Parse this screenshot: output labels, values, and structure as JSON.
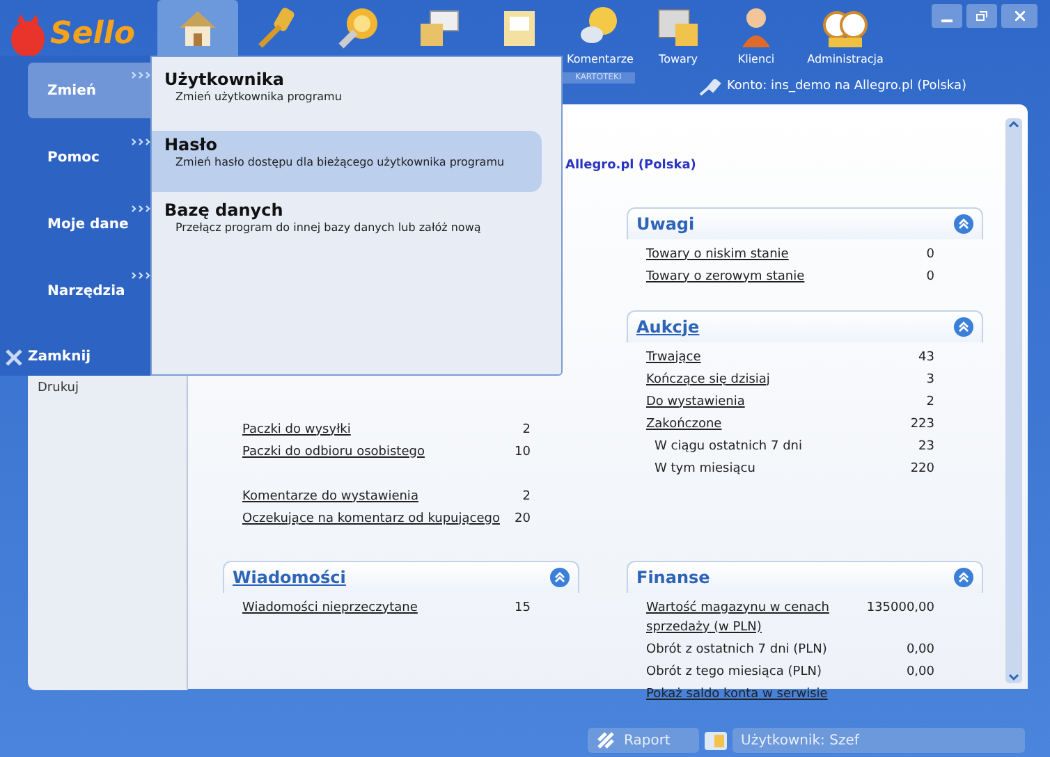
{
  "logo": "Sello",
  "toolbar": [
    {
      "selected": true
    },
    {
      "selected": false
    },
    {
      "selected": false
    },
    {
      "selected": false
    },
    {
      "selected": false
    },
    {
      "label": "Komentarze",
      "selected": false
    },
    {
      "label": "Towary",
      "selected": false
    },
    {
      "label": "Klienci",
      "selected": false
    },
    {
      "label": "Administracja",
      "selected": false
    }
  ],
  "toolbar_group_label": "KARTOTEKI",
  "account": "Konto: ins_demo na Allegro.pl (Polska)",
  "menu": {
    "categories": [
      {
        "label": "Zmień",
        "selected": true
      },
      {
        "label": "Pomoc",
        "selected": false
      },
      {
        "label": "Moje dane",
        "selected": false
      },
      {
        "label": "Narzędzia",
        "selected": false
      }
    ],
    "close": "Zamknij",
    "entries": [
      {
        "title": "Użytkownika",
        "description": "Zmień użytkownika programu",
        "selected": false
      },
      {
        "title": "Hasło",
        "description": "Zmień hasło dostępu dla bieżącego użytkownika programu",
        "selected": true
      },
      {
        "title": "Bazę danych",
        "description": "Przełącz program do innej bazy danych lub załóż nową",
        "selected": false
      }
    ]
  },
  "sidebar": {
    "items": [
      "Drukuj"
    ]
  },
  "main": {
    "account_heading": "Allegro.pl (Polska)",
    "left_rows": [
      {
        "label": "Paczki do wysyłki",
        "value": "2",
        "kind": "link"
      },
      {
        "label": "Paczki do odbioru osobistego",
        "value": "10",
        "kind": "link"
      },
      {
        "kind": "gap"
      },
      {
        "label": "Komentarze do wystawienia",
        "value": "2",
        "kind": "link"
      },
      {
        "label": "Oczekujące na komentarz od kupującego",
        "value": "20",
        "kind": "link"
      }
    ],
    "right_sections": [
      {
        "title": "Uwagi",
        "title_link": false,
        "rows": [
          {
            "label": "Towary o niskim stanie",
            "value": "0",
            "kind": "link"
          },
          {
            "label": "Towary o zerowym stanie",
            "value": "0",
            "kind": "link"
          }
        ]
      },
      {
        "title": "Aukcje",
        "title_link": true,
        "rows": [
          {
            "label": "Trwające",
            "value": "43",
            "kind": "link"
          },
          {
            "label": "Kończące się dzisiaj",
            "value": "3",
            "kind": "link"
          },
          {
            "label": "Do wystawienia",
            "value": "2",
            "kind": "link"
          },
          {
            "label": "Zakończone",
            "value": "223",
            "kind": "link"
          },
          {
            "label": "W ciągu ostatnich 7 dni",
            "value": "23",
            "kind": "sub"
          },
          {
            "label": "W tym miesiącu",
            "value": "220",
            "kind": "sub"
          }
        ]
      }
    ],
    "bottom_sections": [
      {
        "title": "Wiadomości",
        "title_link": true,
        "rows": [
          {
            "label": "Wiadomości nieprzeczytane",
            "value": "15",
            "kind": "link"
          }
        ]
      },
      {
        "title": "Finanse",
        "title_link": false,
        "rows": [
          {
            "label": "Wartość magazynu w cenach sprzedaży (w PLN)",
            "value": "135000,00",
            "kind": "link"
          },
          {
            "label": "Obrót z ostatnich 7 dni (PLN)",
            "value": "0,00",
            "kind": "plain"
          },
          {
            "label": "Obrót z tego miesiąca (PLN)",
            "value": "0,00",
            "kind": "plain"
          },
          {
            "label": "Pokaż saldo konta w serwisie",
            "kind": "link"
          }
        ]
      }
    ]
  },
  "status_bar": {
    "report": "Raport",
    "user": "Użytkownik: Szef"
  }
}
